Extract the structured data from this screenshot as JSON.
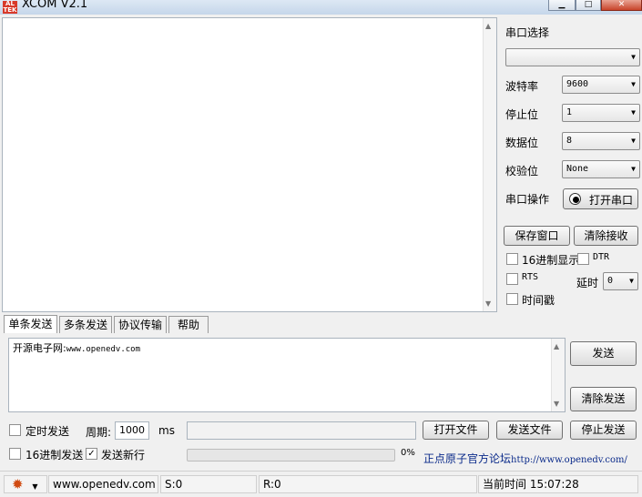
{
  "window": {
    "title": "XCOM V2.1",
    "icon_text": "ALIEN TEK"
  },
  "serial": {
    "port_select_label": "串口选择",
    "port_value": "",
    "baud_label": "波特率",
    "baud_value": "9600",
    "stopbits_label": "停止位",
    "stopbits_value": "1",
    "databits_label": "数据位",
    "databits_value": "8",
    "parity_label": "校验位",
    "parity_value": "None",
    "operation_label": "串口操作",
    "open_button": "打开串口"
  },
  "buttons": {
    "save_window": "保存窗口",
    "clear_receive": "清除接收",
    "send": "发送",
    "clear_send": "清除发送",
    "open_file": "打开文件",
    "send_file": "发送文件",
    "stop_send": "停止发送"
  },
  "options": {
    "hex_display": "16进制显示",
    "dtr": "DTR",
    "rts": "RTS",
    "delay_label": "延时",
    "delay_value": "0",
    "timestamp": "时间戳",
    "timed_send": "定时发送",
    "period_label": "周期:",
    "period_value": "1000",
    "period_unit": "ms",
    "hex_send": "16进制发送",
    "send_newline": "发送新行",
    "send_newline_checked": true,
    "progress_text": "0%",
    "progress_fraction": 0
  },
  "tabs": [
    "单条发送",
    "多条发送",
    "协议传输",
    "帮助"
  ],
  "send_box": {
    "label": "开源电子网:",
    "url": "www.openedv.com"
  },
  "forum": {
    "label": "正点原子官方论坛",
    "url": "http://www.openedv.com/"
  },
  "status": {
    "site": "www.openedv.com",
    "sent": "S:0",
    "received": "R:0",
    "time": "当前时间 15:07:28"
  }
}
